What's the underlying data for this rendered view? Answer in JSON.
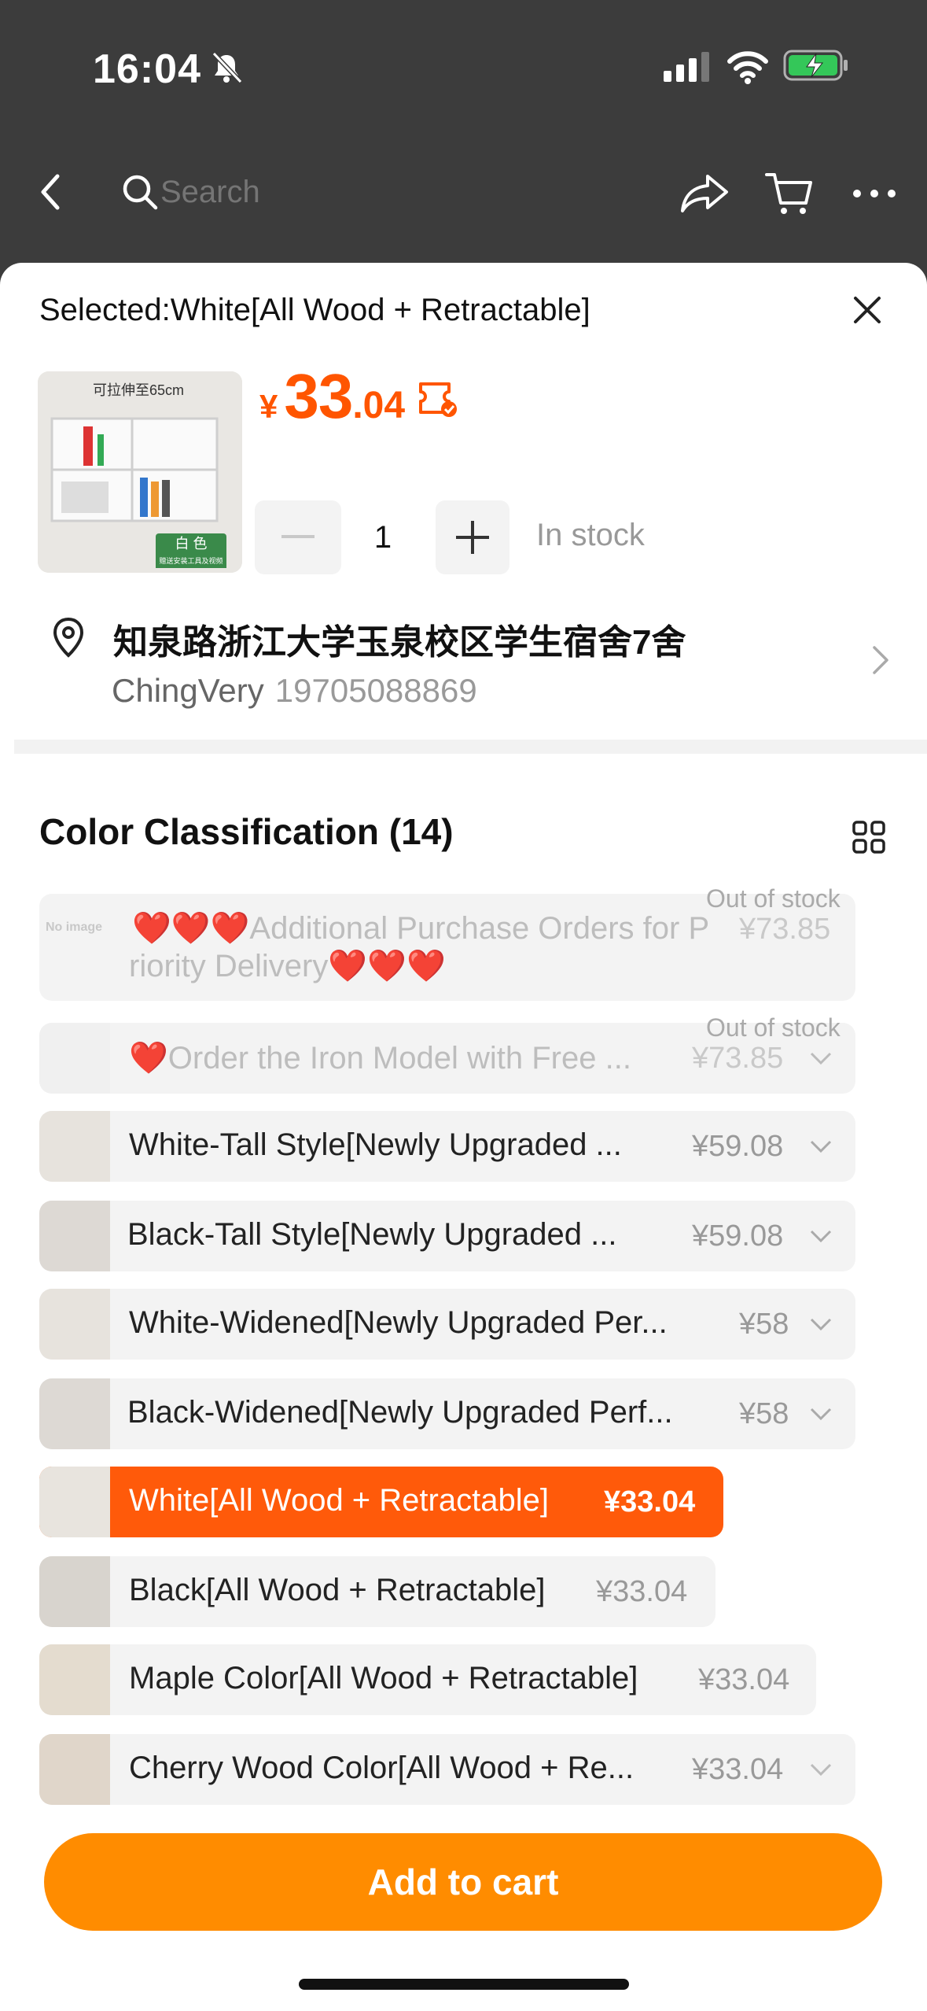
{
  "status": {
    "time": "16:04"
  },
  "topbar": {
    "search_placeholder": "Search"
  },
  "sheet": {
    "selected_label": "Selected:White[All Wood + Retractable]",
    "price": {
      "currency": "¥",
      "integer": "33",
      "decimal": ".04"
    },
    "quantity": "1",
    "stock": "In stock",
    "address": {
      "line": "知泉路浙江大学玉泉校区学生宿舍7舍",
      "name": "ChingVery",
      "phone": "19705088869"
    },
    "section_title": "Color Classification (14)",
    "product_image_text": {
      "top": "可拉伸至65cm",
      "badge": "白 色",
      "badge_sub": "赠送安装工具及视频"
    }
  },
  "options": [
    {
      "label_line1": "❤️❤️❤️Additional Purchase Orders for P",
      "label_line2": "riority Delivery❤️❤️❤️",
      "price": "¥73.85",
      "status": "Out of stock",
      "thumb": "No image"
    },
    {
      "label": "❤️Order the Iron Model with Free ...",
      "price": "¥73.85",
      "status": "Out of stock"
    },
    {
      "label": "White-Tall Style[Newly Upgraded ...",
      "price": "¥59.08"
    },
    {
      "label": "Black-Tall Style[Newly Upgraded ...",
      "price": "¥59.08"
    },
    {
      "label": "White-Widened[Newly Upgraded Per...",
      "price": "¥58"
    },
    {
      "label": "Black-Widened[Newly Upgraded Perf...",
      "price": "¥58"
    },
    {
      "label": "White[All Wood + Retractable]",
      "price": "¥33.04"
    },
    {
      "label": "Black[All Wood + Retractable]",
      "price": "¥33.04"
    },
    {
      "label": "Maple Color[All Wood + Retractable]",
      "price": "¥33.04"
    },
    {
      "label": "Cherry Wood Color[All Wood + Re...",
      "price": "¥33.04"
    }
  ],
  "add_to_cart": "Add to cart",
  "colors": {
    "accent": "#ff5500",
    "selected_bg": "#ff5a0a",
    "button_bg": "#ff8c00"
  }
}
